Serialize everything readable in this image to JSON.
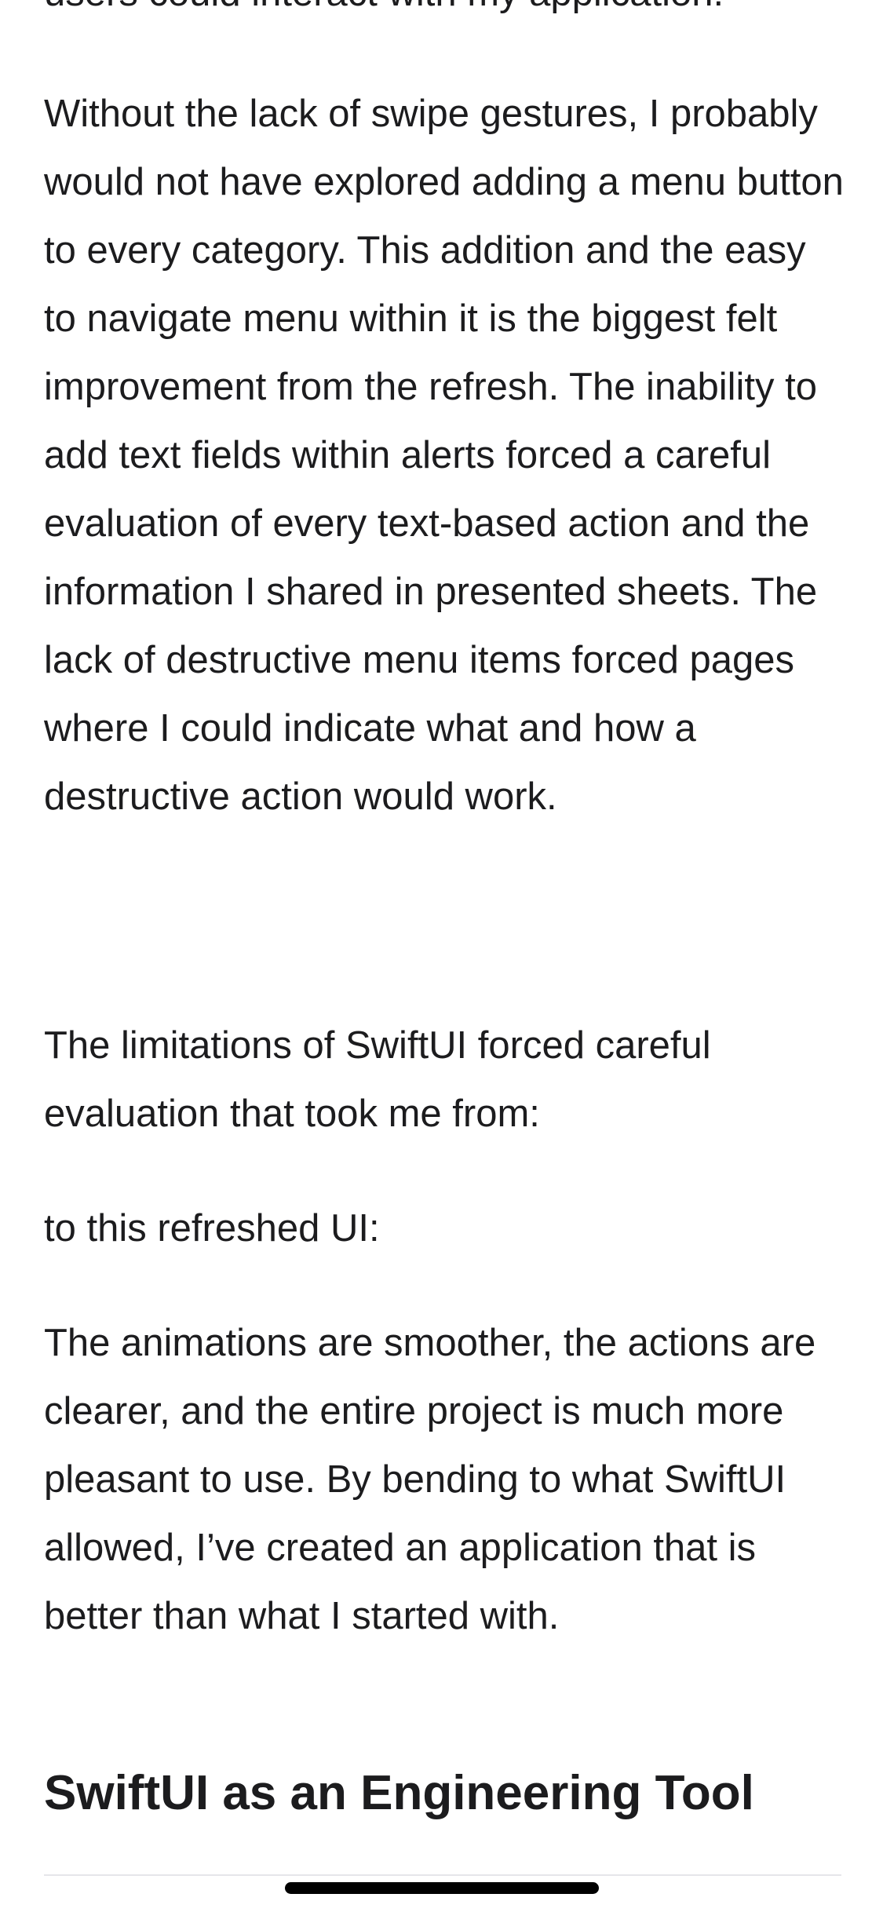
{
  "article": {
    "cut_off_line": "users could interact with my application.",
    "paragraphs": [
      "Without the lack of swipe gestures, I probably would not have explored adding a menu button to every category. This addition and the easy to navigate menu within it is the biggest felt improvement from the refresh. The inability to add text fields within alerts forced a careful evaluation of every text-based action and the information I shared in presented sheets. The lack of destructive menu items forced pages where I could indicate what and how a destructive action would work.",
      "The limitations of SwiftUI forced careful evaluation that took me from:",
      "to this refreshed UI:",
      "The animations are smoother, the actions are clearer, and the entire project is much more pleasant to use. By bending to what SwiftUI allowed, I’ve created an application that is better than what I started with."
    ],
    "section_heading": "SwiftUI as an Engineering Tool"
  }
}
